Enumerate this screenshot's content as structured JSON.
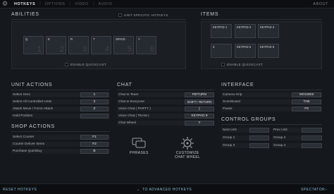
{
  "topbar": {
    "tabs": [
      {
        "label": "HOTKEYS",
        "active": true
      },
      {
        "label": "OPTIONS",
        "active": false
      },
      {
        "label": "VIDEO",
        "active": false
      },
      {
        "label": "AUDIO",
        "active": false
      }
    ],
    "about": "ABOUT"
  },
  "abilities": {
    "title": "ABILITIES",
    "unit_specific": "UNIT SPECIFIC HOTKEYS",
    "enable_quickcast": "ENABLE QUICKCAST",
    "keys": [
      {
        "key": "Q",
        "num": "1"
      },
      {
        "key": "E",
        "num": "2"
      },
      {
        "key": "R",
        "num": "3"
      },
      {
        "key": "T",
        "num": "4"
      },
      {
        "key": "SPACE",
        "num": "5"
      },
      {
        "key": "Y",
        "num": "6"
      }
    ]
  },
  "items": {
    "title": "ITEMS",
    "enable_quickcast": "ENABLE QUICKCAST",
    "keys": [
      "KEYPAD 1",
      "KEYPAD 2",
      "KEYPAD 3",
      "Z",
      "KEYPAD 5",
      "KEYPAD 6"
    ]
  },
  "unit_actions": {
    "title": "UNIT ACTIONS",
    "rows": [
      {
        "label": "Select Hero",
        "key": "1"
      },
      {
        "label": "Select All Controlled Units",
        "key": "3"
      },
      {
        "label": "Attack Move / Force Attack",
        "key": "Z"
      },
      {
        "label": "Hold Position",
        "key": ""
      }
    ]
  },
  "shop_actions": {
    "title": "SHOP ACTIONS",
    "rows": [
      {
        "label": "Select Courier",
        "key": "F1"
      },
      {
        "label": "Courier Deliver Items",
        "key": "F2"
      },
      {
        "label": "Purchase Quickbuy",
        "key": "B"
      }
    ]
  },
  "chat": {
    "title": "CHAT",
    "rows": [
      {
        "label": "Chat to Team",
        "key": "RETURN"
      },
      {
        "label": "Chat to Everyone",
        "key": "SHIFT+ RETURN"
      },
      {
        "label": "Voice Chat ( PARTY )",
        "key": "["
      },
      {
        "label": "Voice Chat ( TEAM )",
        "key": "KEYPAD 9"
      },
      {
        "label": "Chat Wheel",
        "key": "Y"
      }
    ],
    "phrases": "PHRASES",
    "customize_1": "CUSTOMIZE",
    "customize_2": "CHAT WHEEL"
  },
  "interface": {
    "title": "INTERFACE",
    "rows": [
      {
        "label": "Camera Grip",
        "key": "MOUSE5"
      },
      {
        "label": "Scoreboard",
        "key": "TAB"
      },
      {
        "label": "Pause",
        "key": "F9"
      }
    ]
  },
  "control_groups": {
    "title": "CONTROL GROUPS",
    "pairs": [
      {
        "left": "Next Unit",
        "right": "Prev Unit"
      },
      {
        "left": "Group 1",
        "right": "Group 2"
      },
      {
        "left": "Group 3",
        "right": "Group 4"
      }
    ]
  },
  "bottombar": {
    "reset": "RESET HOTKEYS",
    "advanced": "TO ADVANCED HOTKEYS",
    "spectator": "SPECTATOR"
  }
}
